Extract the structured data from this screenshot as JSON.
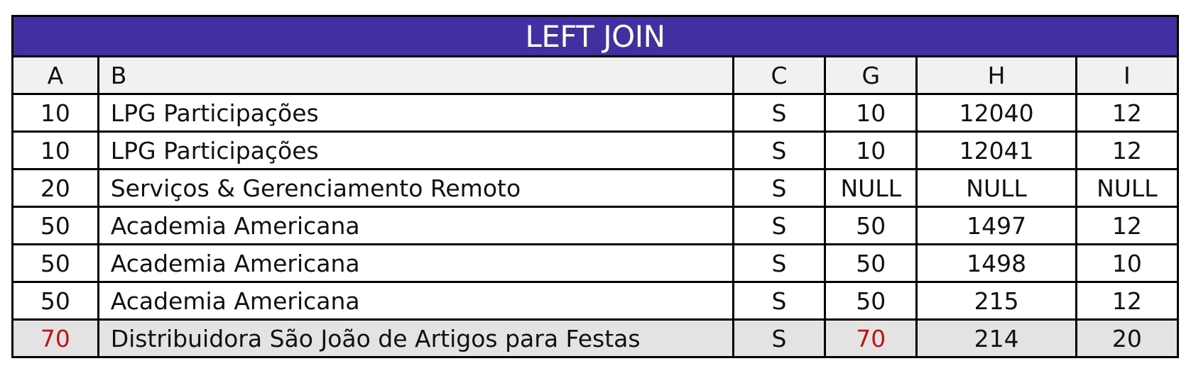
{
  "table": {
    "title": "LEFT JOIN",
    "columns": [
      "A",
      "B",
      "C",
      "G",
      "H",
      "I"
    ],
    "rows": [
      {
        "A": "10",
        "B": "LPG Participações",
        "C": "S",
        "G": "10",
        "H": "12040",
        "I": "12"
      },
      {
        "A": "10",
        "B": "LPG Participações",
        "C": "S",
        "G": "10",
        "H": "12041",
        "I": "12"
      },
      {
        "A": "20",
        "B": "Serviços & Gerenciamento Remoto",
        "C": "S",
        "G": "NULL",
        "H": "NULL",
        "I": "NULL"
      },
      {
        "A": "50",
        "B": "Academia Americana",
        "C": "S",
        "G": "50",
        "H": "1497",
        "I": "12"
      },
      {
        "A": "50",
        "B": "Academia Americana",
        "C": "S",
        "G": "50",
        "H": "1498",
        "I": "10"
      },
      {
        "A": "50",
        "B": "Academia Americana",
        "C": "S",
        "G": "50",
        "H": "215",
        "I": "12"
      },
      {
        "A": "70",
        "B": "Distribuidora São João de Artigos para Festas",
        "C": "S",
        "G": "70",
        "H": "214",
        "I": "20"
      }
    ],
    "colors": {
      "title_background": "#4230a2",
      "header_background": "#f1f1f1",
      "highlight_row_background": "#e3e3e3",
      "highlight_text": "#c0140e"
    }
  }
}
